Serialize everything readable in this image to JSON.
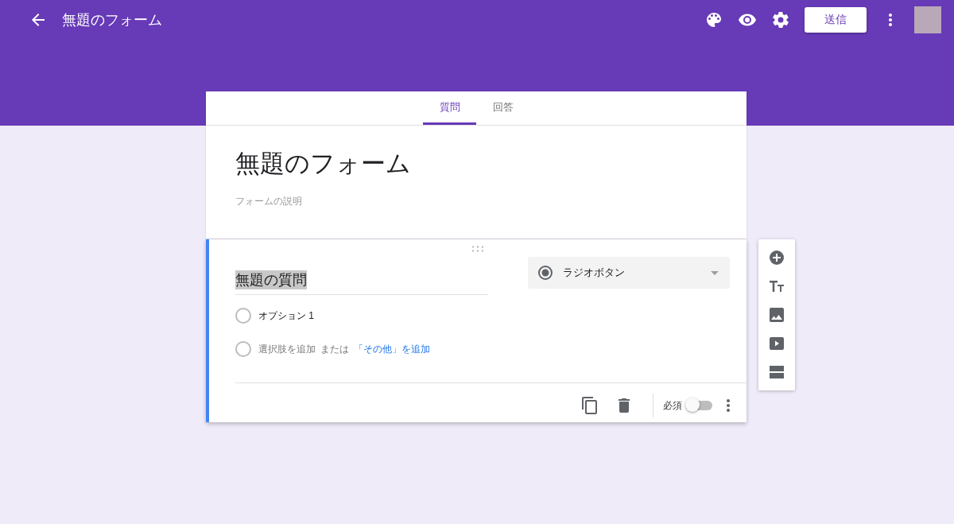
{
  "header": {
    "title": "無題のフォーム",
    "send_button": "送信"
  },
  "tabs": [
    {
      "label": "質問",
      "selected": true
    },
    {
      "label": "回答",
      "selected": false
    }
  ],
  "form": {
    "title": "無題のフォーム",
    "description": {
      "placeholder": "フォームの説明"
    }
  },
  "question": {
    "title": "無題の質問",
    "type": "ラジオボタン",
    "options": [
      {
        "label": "オプション 1"
      }
    ],
    "add_option": "選択肢を追加",
    "or": "または",
    "add_other": "「その他」を追加",
    "required_label": "必須",
    "required": false
  }
}
